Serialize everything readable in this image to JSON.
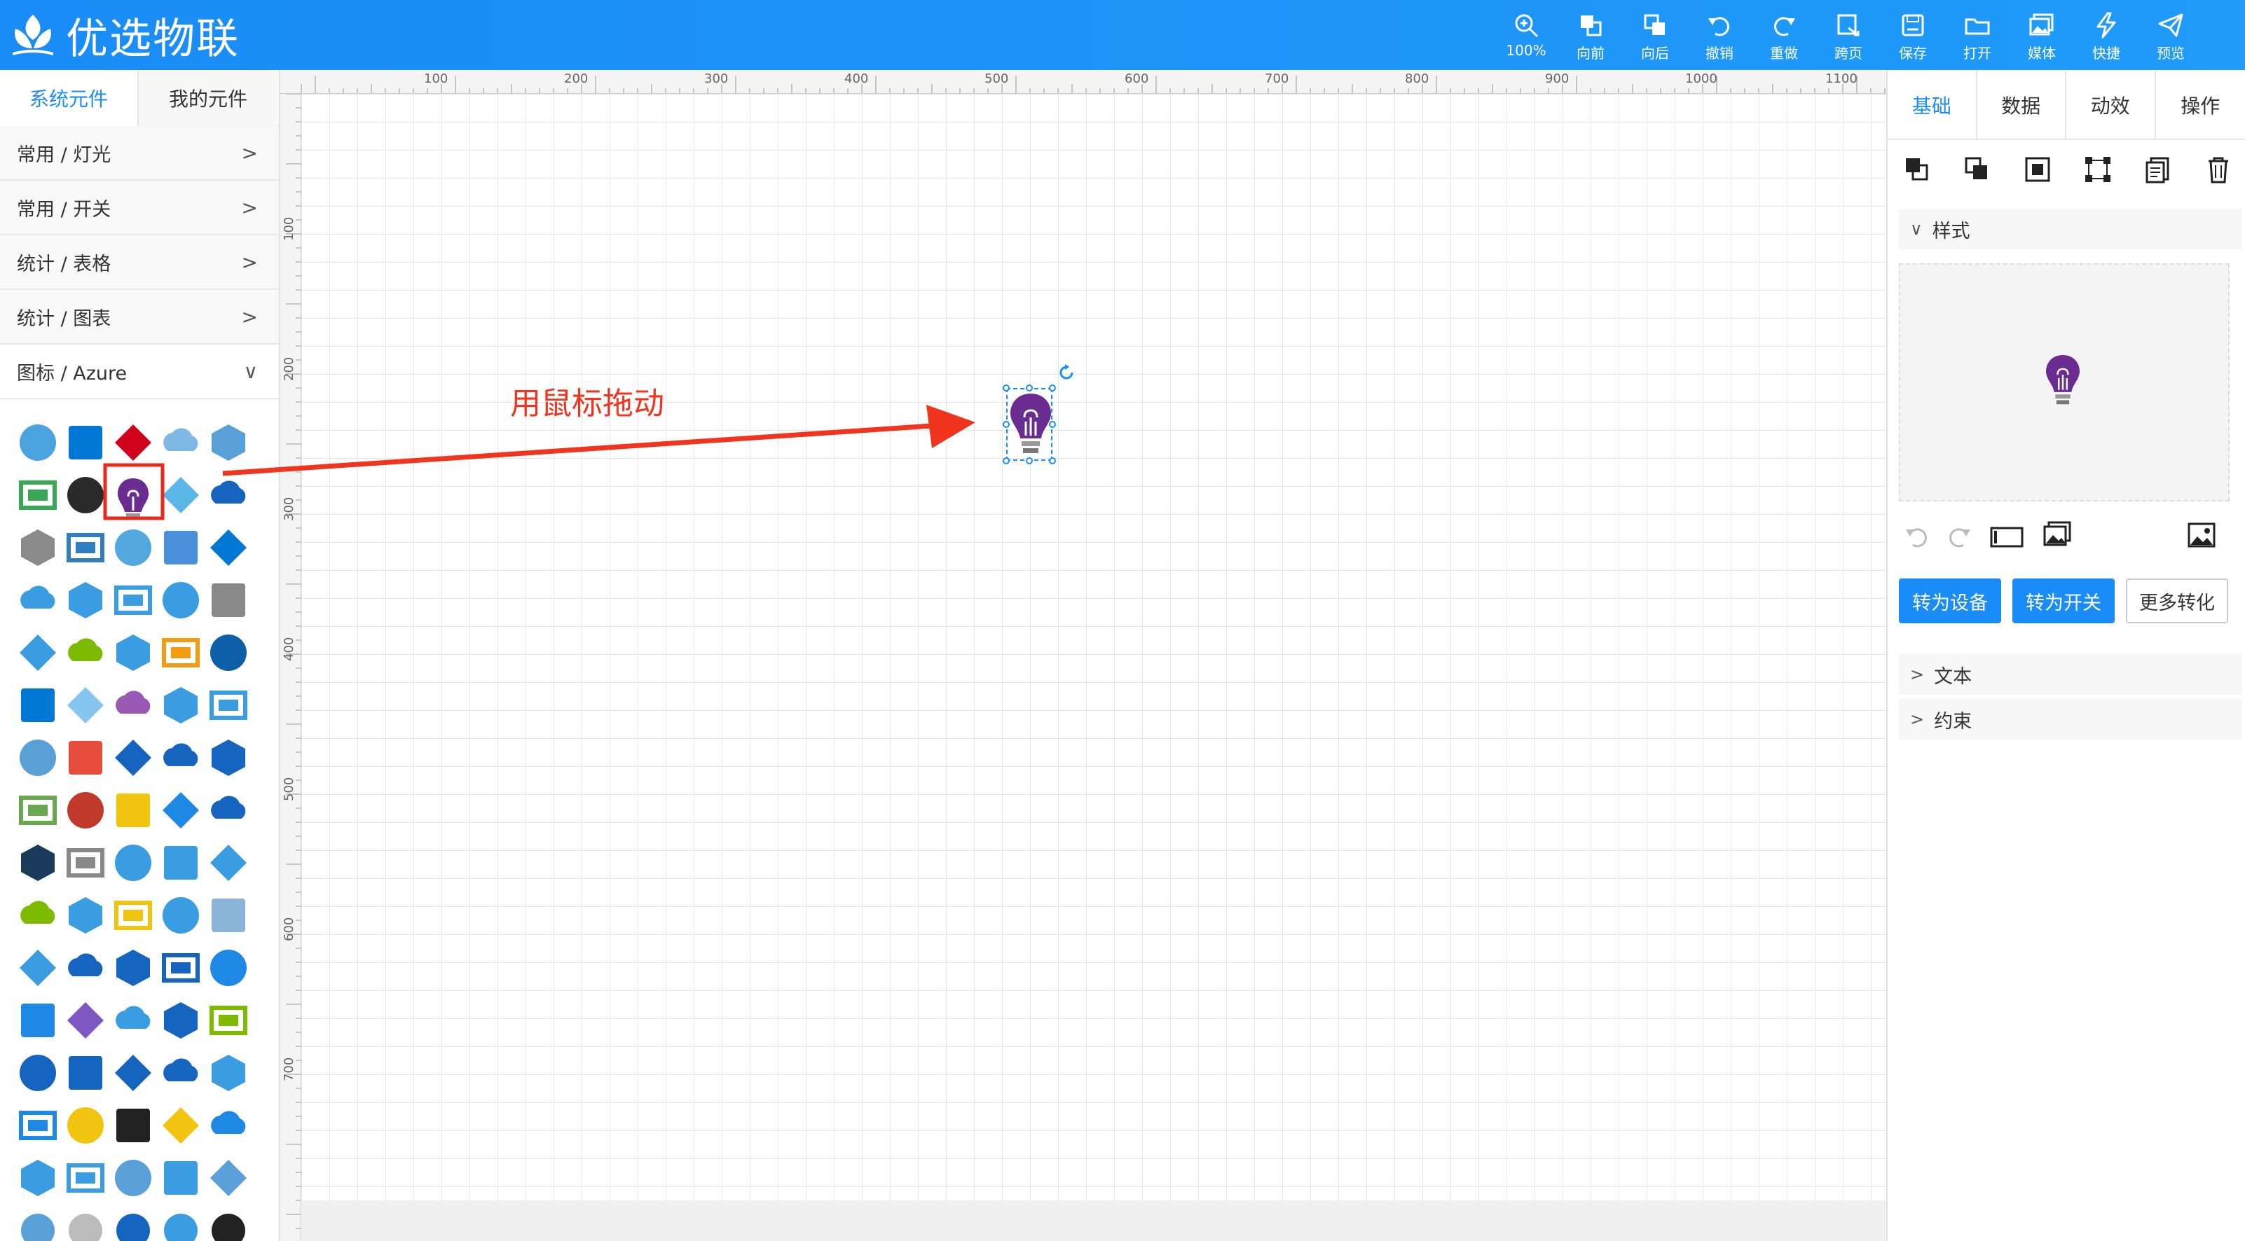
{
  "app": {
    "title": "优选物联"
  },
  "toolbar": [
    {
      "label": "100%",
      "icon": "zoom-in-icon"
    },
    {
      "label": "向前",
      "icon": "bring-forward-icon"
    },
    {
      "label": "向后",
      "icon": "send-backward-icon"
    },
    {
      "label": "撤销",
      "icon": "undo-icon"
    },
    {
      "label": "重做",
      "icon": "redo-icon"
    },
    {
      "label": "跨页",
      "icon": "cross-page-icon"
    },
    {
      "label": "保存",
      "icon": "save-icon"
    },
    {
      "label": "打开",
      "icon": "folder-open-icon"
    },
    {
      "label": "媒体",
      "icon": "media-icon"
    },
    {
      "label": "快捷",
      "icon": "lightning-icon"
    },
    {
      "label": "预览",
      "icon": "send-preview-icon"
    }
  ],
  "left": {
    "tabs": [
      "系统元件",
      "我的元件"
    ],
    "categories": [
      {
        "label": "常用 / 灯光",
        "expanded": false
      },
      {
        "label": "常用 / 开关",
        "expanded": false
      },
      {
        "label": "统计 / 表格",
        "expanded": false
      },
      {
        "label": "统计 / 图表",
        "expanded": false
      },
      {
        "label": "图标 / Azure",
        "expanded": true
      }
    ]
  },
  "annotation": {
    "text": "用鼠标拖动",
    "color": "#f0341e"
  },
  "ruler": {
    "top": [
      "100",
      "200",
      "300",
      "400",
      "500",
      "600",
      "700",
      "800",
      "900",
      "1000",
      "1100"
    ],
    "left": [
      "100",
      "200",
      "300",
      "400",
      "500",
      "600",
      "700"
    ]
  },
  "right": {
    "tabs": [
      "基础",
      "数据",
      "动效",
      "操作"
    ],
    "sections": {
      "style": "样式",
      "text": "文本",
      "constraint": "约束"
    },
    "buttons": {
      "to_device": "转为设备",
      "to_switch": "转为开关",
      "more": "更多转化"
    }
  },
  "colors": {
    "accent": "#1a8cf7",
    "header": "#1f9bfa",
    "bulb": "#6b2c91"
  }
}
